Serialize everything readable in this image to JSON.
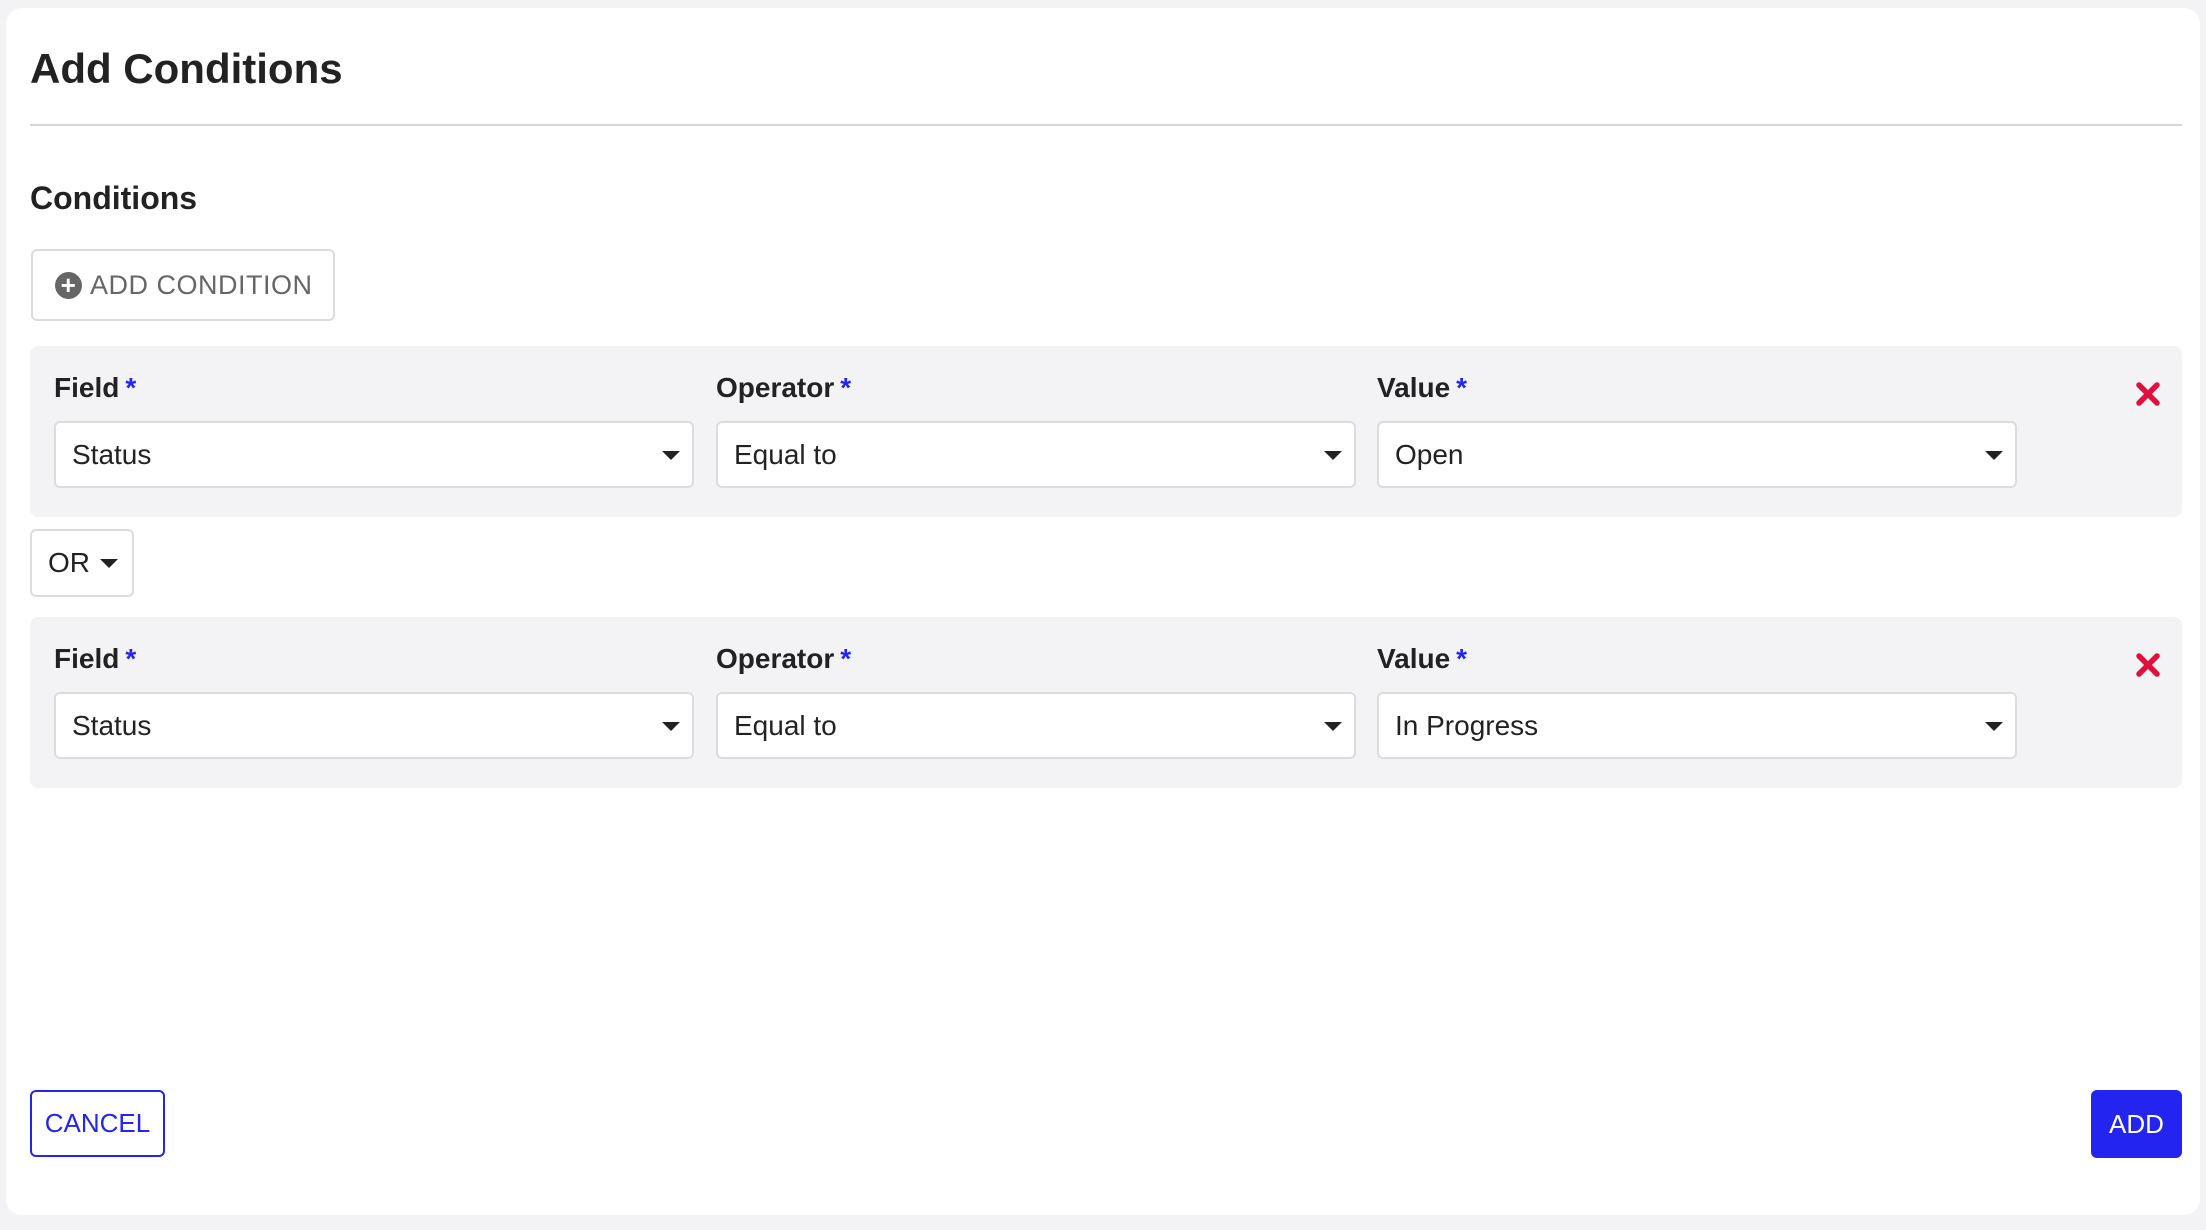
{
  "dialog": {
    "title": "Add Conditions",
    "section_title": "Conditions",
    "add_condition_label": "ADD CONDITION",
    "add_condition_icon": "plus-circle-icon"
  },
  "labels": {
    "field": "Field",
    "operator": "Operator",
    "value": "Value",
    "required_mark": "*"
  },
  "conditions": [
    {
      "field": "Status",
      "operator": "Equal to",
      "value": "Open"
    },
    {
      "field": "Status",
      "operator": "Equal to",
      "value": "In Progress"
    }
  ],
  "logic_operator": "OR",
  "footer": {
    "cancel_label": "CANCEL",
    "add_label": "ADD"
  },
  "colors": {
    "accent": "#2424f0",
    "remove": "#e0103c",
    "panel_bg": "#f3f3f5"
  },
  "icons": {
    "remove": "close-x-icon",
    "dropdown": "caret-down-icon"
  }
}
